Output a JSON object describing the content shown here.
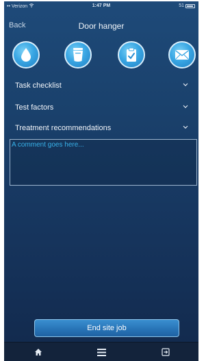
{
  "status_bar": {
    "carrier": "•• Verizon",
    "time": "1:47 PM",
    "battery": "51"
  },
  "nav": {
    "back_label": "Back",
    "title": "Door hanger"
  },
  "actions": [
    {
      "icon": "water-drop-icon"
    },
    {
      "icon": "bucket-icon"
    },
    {
      "icon": "clipboard-check-icon"
    },
    {
      "icon": "envelope-icon"
    }
  ],
  "sections": [
    {
      "label": "Task checklist"
    },
    {
      "label": "Test factors"
    },
    {
      "label": "Treatment recommendations"
    }
  ],
  "comment": {
    "placeholder": "A comment goes here..."
  },
  "end_button": {
    "label": "End site job"
  },
  "tab_bar": {
    "items": [
      {
        "icon": "home-icon"
      },
      {
        "icon": "menu-icon"
      },
      {
        "icon": "logout-icon"
      }
    ]
  },
  "colors": {
    "background_top": "#1e4a79",
    "background_bottom": "#12294c",
    "accent_blue": "#3aa7e4",
    "placeholder_text": "#38b2ea",
    "button": "#2874b7",
    "tab_bar": "#13233b"
  }
}
